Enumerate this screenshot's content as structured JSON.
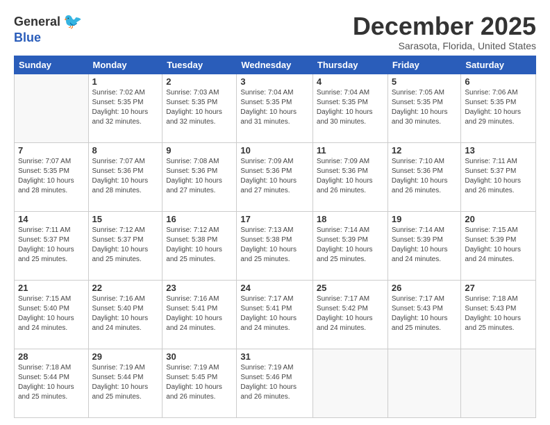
{
  "logo": {
    "general": "General",
    "blue": "Blue"
  },
  "title": "December 2025",
  "location": "Sarasota, Florida, United States",
  "weekdays": [
    "Sunday",
    "Monday",
    "Tuesday",
    "Wednesday",
    "Thursday",
    "Friday",
    "Saturday"
  ],
  "weeks": [
    [
      {
        "day": "",
        "info": ""
      },
      {
        "day": "1",
        "info": "Sunrise: 7:02 AM\nSunset: 5:35 PM\nDaylight: 10 hours\nand 32 minutes."
      },
      {
        "day": "2",
        "info": "Sunrise: 7:03 AM\nSunset: 5:35 PM\nDaylight: 10 hours\nand 32 minutes."
      },
      {
        "day": "3",
        "info": "Sunrise: 7:04 AM\nSunset: 5:35 PM\nDaylight: 10 hours\nand 31 minutes."
      },
      {
        "day": "4",
        "info": "Sunrise: 7:04 AM\nSunset: 5:35 PM\nDaylight: 10 hours\nand 30 minutes."
      },
      {
        "day": "5",
        "info": "Sunrise: 7:05 AM\nSunset: 5:35 PM\nDaylight: 10 hours\nand 30 minutes."
      },
      {
        "day": "6",
        "info": "Sunrise: 7:06 AM\nSunset: 5:35 PM\nDaylight: 10 hours\nand 29 minutes."
      }
    ],
    [
      {
        "day": "7",
        "info": "Sunrise: 7:07 AM\nSunset: 5:35 PM\nDaylight: 10 hours\nand 28 minutes."
      },
      {
        "day": "8",
        "info": "Sunrise: 7:07 AM\nSunset: 5:36 PM\nDaylight: 10 hours\nand 28 minutes."
      },
      {
        "day": "9",
        "info": "Sunrise: 7:08 AM\nSunset: 5:36 PM\nDaylight: 10 hours\nand 27 minutes."
      },
      {
        "day": "10",
        "info": "Sunrise: 7:09 AM\nSunset: 5:36 PM\nDaylight: 10 hours\nand 27 minutes."
      },
      {
        "day": "11",
        "info": "Sunrise: 7:09 AM\nSunset: 5:36 PM\nDaylight: 10 hours\nand 26 minutes."
      },
      {
        "day": "12",
        "info": "Sunrise: 7:10 AM\nSunset: 5:36 PM\nDaylight: 10 hours\nand 26 minutes."
      },
      {
        "day": "13",
        "info": "Sunrise: 7:11 AM\nSunset: 5:37 PM\nDaylight: 10 hours\nand 26 minutes."
      }
    ],
    [
      {
        "day": "14",
        "info": "Sunrise: 7:11 AM\nSunset: 5:37 PM\nDaylight: 10 hours\nand 25 minutes."
      },
      {
        "day": "15",
        "info": "Sunrise: 7:12 AM\nSunset: 5:37 PM\nDaylight: 10 hours\nand 25 minutes."
      },
      {
        "day": "16",
        "info": "Sunrise: 7:12 AM\nSunset: 5:38 PM\nDaylight: 10 hours\nand 25 minutes."
      },
      {
        "day": "17",
        "info": "Sunrise: 7:13 AM\nSunset: 5:38 PM\nDaylight: 10 hours\nand 25 minutes."
      },
      {
        "day": "18",
        "info": "Sunrise: 7:14 AM\nSunset: 5:39 PM\nDaylight: 10 hours\nand 25 minutes."
      },
      {
        "day": "19",
        "info": "Sunrise: 7:14 AM\nSunset: 5:39 PM\nDaylight: 10 hours\nand 24 minutes."
      },
      {
        "day": "20",
        "info": "Sunrise: 7:15 AM\nSunset: 5:39 PM\nDaylight: 10 hours\nand 24 minutes."
      }
    ],
    [
      {
        "day": "21",
        "info": "Sunrise: 7:15 AM\nSunset: 5:40 PM\nDaylight: 10 hours\nand 24 minutes."
      },
      {
        "day": "22",
        "info": "Sunrise: 7:16 AM\nSunset: 5:40 PM\nDaylight: 10 hours\nand 24 minutes."
      },
      {
        "day": "23",
        "info": "Sunrise: 7:16 AM\nSunset: 5:41 PM\nDaylight: 10 hours\nand 24 minutes."
      },
      {
        "day": "24",
        "info": "Sunrise: 7:17 AM\nSunset: 5:41 PM\nDaylight: 10 hours\nand 24 minutes."
      },
      {
        "day": "25",
        "info": "Sunrise: 7:17 AM\nSunset: 5:42 PM\nDaylight: 10 hours\nand 24 minutes."
      },
      {
        "day": "26",
        "info": "Sunrise: 7:17 AM\nSunset: 5:43 PM\nDaylight: 10 hours\nand 25 minutes."
      },
      {
        "day": "27",
        "info": "Sunrise: 7:18 AM\nSunset: 5:43 PM\nDaylight: 10 hours\nand 25 minutes."
      }
    ],
    [
      {
        "day": "28",
        "info": "Sunrise: 7:18 AM\nSunset: 5:44 PM\nDaylight: 10 hours\nand 25 minutes."
      },
      {
        "day": "29",
        "info": "Sunrise: 7:19 AM\nSunset: 5:44 PM\nDaylight: 10 hours\nand 25 minutes."
      },
      {
        "day": "30",
        "info": "Sunrise: 7:19 AM\nSunset: 5:45 PM\nDaylight: 10 hours\nand 26 minutes."
      },
      {
        "day": "31",
        "info": "Sunrise: 7:19 AM\nSunset: 5:46 PM\nDaylight: 10 hours\nand 26 minutes."
      },
      {
        "day": "",
        "info": ""
      },
      {
        "day": "",
        "info": ""
      },
      {
        "day": "",
        "info": ""
      }
    ]
  ]
}
